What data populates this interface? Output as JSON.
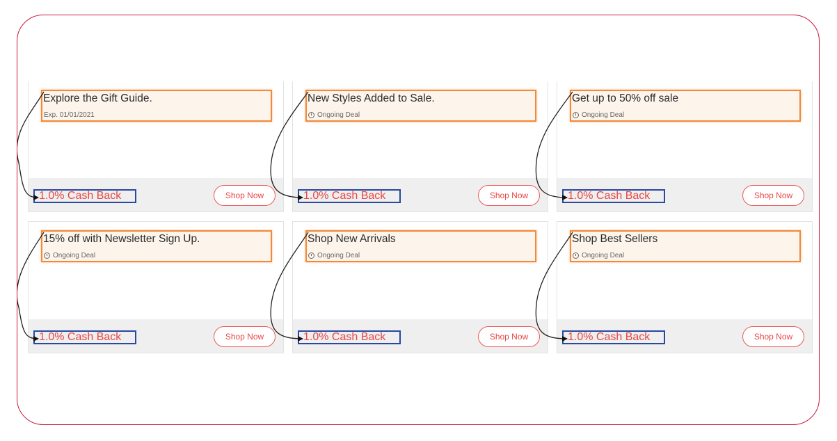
{
  "cards": [
    {
      "title": "Explore the Gift Guide.",
      "meta": "Exp. 01/01/2021",
      "has_clock": false,
      "cashback": "1.0% Cash Back",
      "button": "Shop Now"
    },
    {
      "title": "New Styles Added to Sale.",
      "meta": "Ongoing Deal",
      "has_clock": true,
      "cashback": "1.0% Cash Back",
      "button": "Shop Now"
    },
    {
      "title": "Get up to 50% off sale",
      "meta": "Ongoing Deal",
      "has_clock": true,
      "cashback": "1.0% Cash Back",
      "button": "Shop Now"
    },
    {
      "title": "15% off with Newsletter Sign Up.",
      "meta": "Ongoing Deal",
      "has_clock": true,
      "cashback": "1.0% Cash Back",
      "button": "Shop Now"
    },
    {
      "title": "Shop New Arrivals",
      "meta": "Ongoing Deal",
      "has_clock": true,
      "cashback": "1.0% Cash Back",
      "button": "Shop Now"
    },
    {
      "title": "Shop Best Sellers",
      "meta": "Ongoing Deal",
      "has_clock": true,
      "cashback": "1.0% Cash Back",
      "button": "Shop Now"
    }
  ],
  "colors": {
    "frame": "#c9173f",
    "highlight_orange": "#f08a3a",
    "highlight_blue": "#2849a0",
    "accent_red": "#e94545"
  },
  "icons": {
    "clock": "clock-icon",
    "arrow": "annotation-arrow"
  }
}
